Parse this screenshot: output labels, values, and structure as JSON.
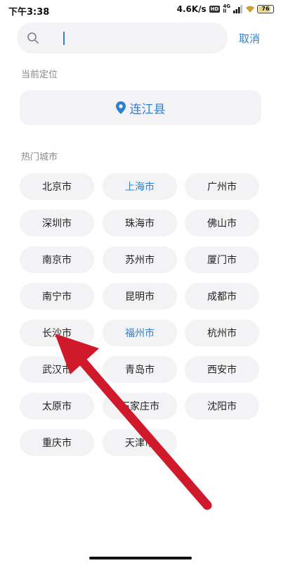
{
  "status_bar": {
    "time": "下午3:38",
    "speed": "4.6K/s",
    "hd": "HD",
    "net_top": "4G",
    "net_bottom": "ll",
    "battery": "76",
    "battery_fraction": 0.76,
    "battery_color": "#e9d48a"
  },
  "search": {
    "value": "",
    "placeholder": "",
    "icon": "search-icon",
    "cancel_label": "取消"
  },
  "current_location": {
    "section_label": "当前定位",
    "city": "连江县",
    "icon": "location-pin-icon"
  },
  "hot_cities": {
    "section_label": "热门城市",
    "items": [
      {
        "label": "北京市",
        "active": false
      },
      {
        "label": "上海市",
        "active": true
      },
      {
        "label": "广州市",
        "active": false
      },
      {
        "label": "深圳市",
        "active": false
      },
      {
        "label": "珠海市",
        "active": false
      },
      {
        "label": "佛山市",
        "active": false
      },
      {
        "label": "南京市",
        "active": false
      },
      {
        "label": "苏州市",
        "active": false
      },
      {
        "label": "厦门市",
        "active": false
      },
      {
        "label": "南宁市",
        "active": false
      },
      {
        "label": "昆明市",
        "active": false
      },
      {
        "label": "成都市",
        "active": false
      },
      {
        "label": "长沙市",
        "active": false
      },
      {
        "label": "福州市",
        "active": true
      },
      {
        "label": "杭州市",
        "active": false
      },
      {
        "label": "武汉市",
        "active": false
      },
      {
        "label": "青岛市",
        "active": false
      },
      {
        "label": "西安市",
        "active": false
      },
      {
        "label": "太原市",
        "active": false
      },
      {
        "label": "石家庄市",
        "active": false
      },
      {
        "label": "沈阳市",
        "active": false
      },
      {
        "label": "重庆市",
        "active": false
      },
      {
        "label": "天津市",
        "active": false
      }
    ]
  },
  "colors": {
    "accent": "#2f7fd0",
    "chip_bg": "#f3f3f5",
    "annotation_arrow": "#d0192b"
  }
}
